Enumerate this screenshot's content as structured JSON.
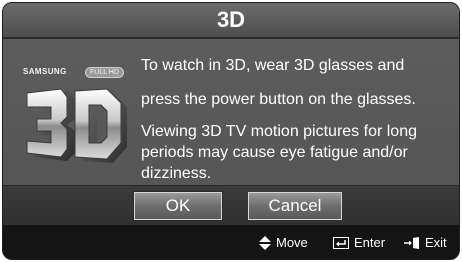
{
  "dialog": {
    "title": "3D",
    "logo": {
      "brand": "SAMSUNG",
      "badge": "FULL HD"
    },
    "message": {
      "line1": "To watch in 3D, wear 3D glasses and",
      "line2": "press the power button on the glasses.",
      "warning": "Viewing 3D TV motion pictures for long periods may cause eye fatigue and/or dizziness."
    },
    "buttons": {
      "ok": "OK",
      "cancel": "Cancel"
    },
    "footer": {
      "move": {
        "icon": "updown-arrow-icon",
        "label": "Move"
      },
      "enter": {
        "icon": "enter-icon",
        "label": "Enter"
      },
      "exit": {
        "icon": "exit-icon",
        "label": "Exit"
      }
    }
  }
}
